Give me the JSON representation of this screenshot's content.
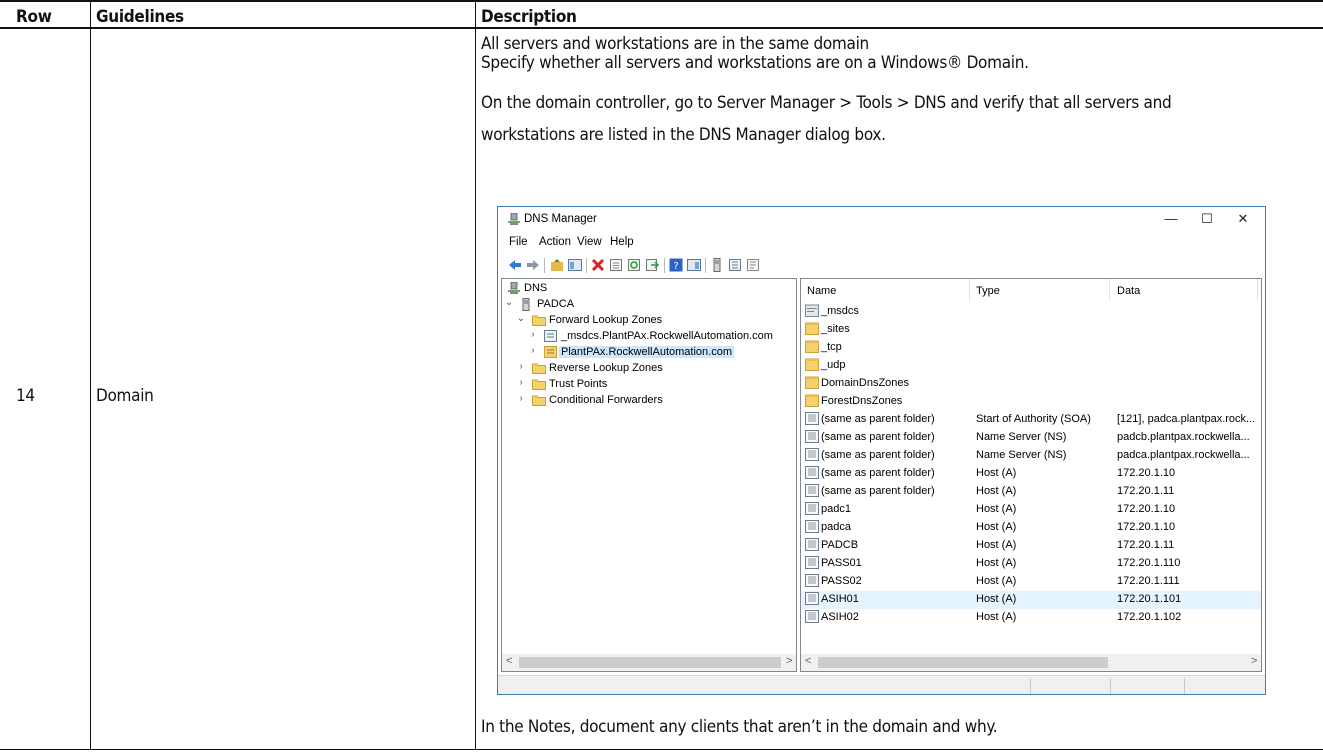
{
  "table": {
    "headers": {
      "row": "Row",
      "guidelines": "Guidelines",
      "description": "Description"
    },
    "row_number": "14",
    "guideline": "Domain",
    "description": {
      "line1": "All servers and workstations are in the same domain",
      "line2": "Specify whether all servers and workstations are on a Windows® Domain.",
      "line3": "On the domain controller, go to Server Manager > Tools > DNS and verify that all servers and",
      "line4": "workstations are listed in the DNS Manager dialog box.",
      "notes": "In the Notes, document any clients that aren’t in the domain and why."
    }
  },
  "dns_window": {
    "title": "DNS Manager",
    "title_icon": "dns-server-icon",
    "window_buttons": {
      "minimize": "—",
      "maximize": "☐",
      "close": "✕"
    },
    "menu": [
      "File",
      "Action",
      "View",
      "Help"
    ],
    "toolbar_icons": [
      "back-arrow-icon",
      "forward-arrow-icon",
      "up-folder-icon",
      "show-hide-tree-icon",
      "delete-icon",
      "properties-icon",
      "refresh-icon",
      "export-list-icon",
      "help-icon",
      "console-icon",
      "server-icon",
      "zone-icon",
      "record-icon"
    ],
    "tree": [
      {
        "label": "DNS",
        "chev": "",
        "icon": "dns-icon"
      },
      {
        "label": "PADCA",
        "chev": "⌄",
        "icon": "server-icon"
      },
      {
        "label": "Forward Lookup Zones",
        "chev": "⌄",
        "icon": "folder-icon"
      },
      {
        "label": "_msdcs.PlantPAx.RockwellAutomation.com",
        "chev": "›",
        "icon": "zone-icon"
      },
      {
        "label": "PlantPAx.RockwellAutomation.com",
        "chev": "›",
        "icon": "zone-icon"
      },
      {
        "label": "Reverse Lookup Zones",
        "chev": "›",
        "icon": "folder-icon"
      },
      {
        "label": "Trust Points",
        "chev": "›",
        "icon": "folder-icon"
      },
      {
        "label": "Conditional Forwarders",
        "chev": "›",
        "icon": "folder-icon"
      }
    ],
    "columns": {
      "name": "Name",
      "type": "Type",
      "data": "Data"
    },
    "records": [
      {
        "name": "_msdcs",
        "type": "",
        "data": "",
        "icon": "delegated-folder-icon"
      },
      {
        "name": "_sites",
        "type": "",
        "data": "",
        "icon": "folder-icon"
      },
      {
        "name": "_tcp",
        "type": "",
        "data": "",
        "icon": "folder-icon"
      },
      {
        "name": "_udp",
        "type": "",
        "data": "",
        "icon": "folder-icon"
      },
      {
        "name": "DomainDnsZones",
        "type": "",
        "data": "",
        "icon": "folder-icon"
      },
      {
        "name": "ForestDnsZones",
        "type": "",
        "data": "",
        "icon": "folder-icon"
      },
      {
        "name": "(same as parent folder)",
        "type": "Start of Authority (SOA)",
        "data": "[121], padca.plantpax.rock...",
        "icon": "record-icon"
      },
      {
        "name": "(same as parent folder)",
        "type": "Name Server (NS)",
        "data": "padcb.plantpax.rockwella...",
        "icon": "record-icon"
      },
      {
        "name": "(same as parent folder)",
        "type": "Name Server (NS)",
        "data": "padca.plantpax.rockwella...",
        "icon": "record-icon"
      },
      {
        "name": "(same as parent folder)",
        "type": "Host (A)",
        "data": "172.20.1.10",
        "icon": "record-icon"
      },
      {
        "name": "(same as parent folder)",
        "type": "Host (A)",
        "data": "172.20.1.11",
        "icon": "record-icon"
      },
      {
        "name": "padc1",
        "type": "Host (A)",
        "data": "172.20.1.10",
        "icon": "record-icon"
      },
      {
        "name": "padca",
        "type": "Host (A)",
        "data": "172.20.1.10",
        "icon": "record-icon"
      },
      {
        "name": "PADCB",
        "type": "Host (A)",
        "data": "172.20.1.11",
        "icon": "record-icon"
      },
      {
        "name": "PASS01",
        "type": "Host (A)",
        "data": "172.20.1.110",
        "icon": "record-icon"
      },
      {
        "name": "PASS02",
        "type": "Host (A)",
        "data": "172.20.1.111",
        "icon": "record-icon"
      },
      {
        "name": "ASIH01",
        "type": "Host (A)",
        "data": "172.20.1.101",
        "icon": "record-icon",
        "highlighted": true
      },
      {
        "name": "ASIH02",
        "type": "Host (A)",
        "data": "172.20.1.102",
        "icon": "record-icon"
      }
    ],
    "colors": {
      "selection": "#cce8ff",
      "hover_row": "#e5f3ff",
      "window_border": "#3c7fb1",
      "folder": "#f5d16b"
    }
  }
}
